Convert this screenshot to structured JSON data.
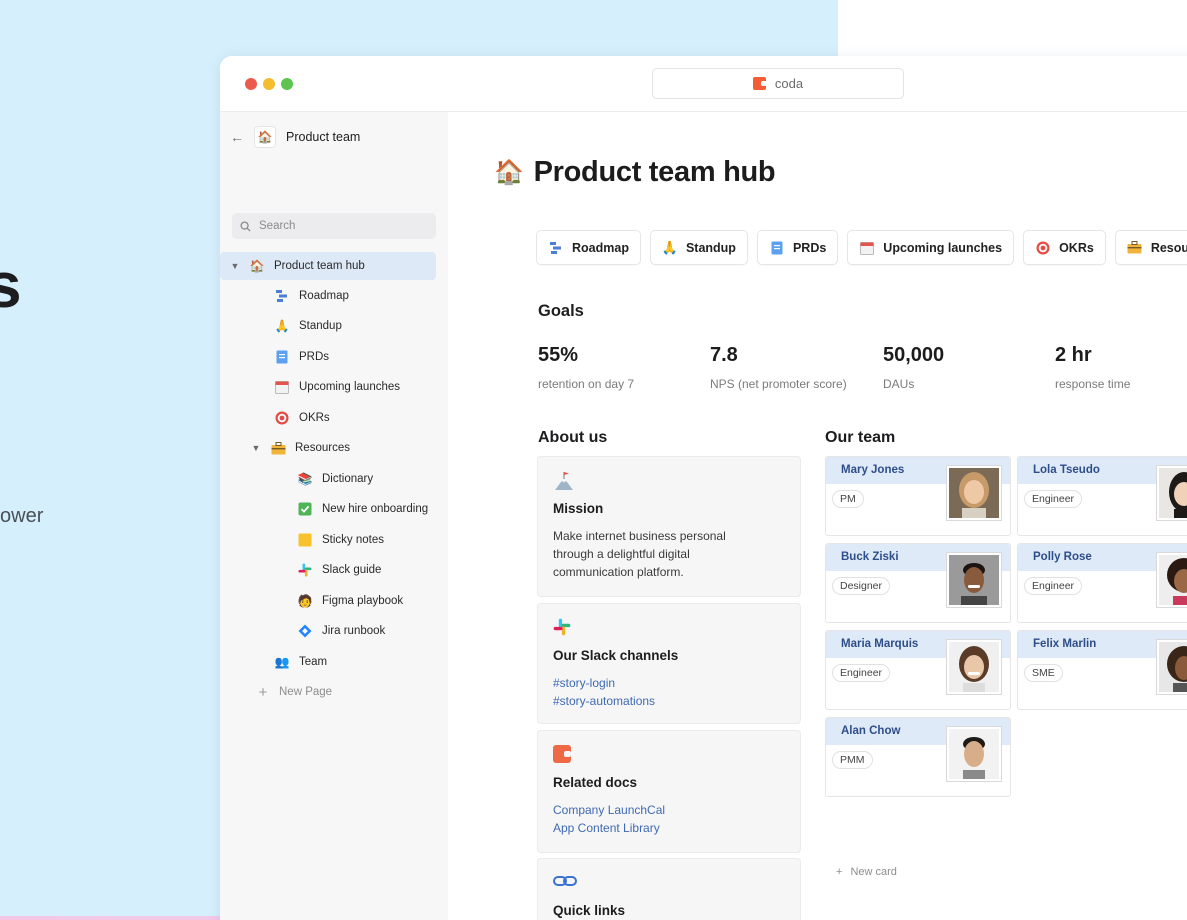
{
  "hero": {
    "partial_glyph": "s",
    "partial_word": "ower"
  },
  "browser": {
    "address": "coda"
  },
  "sidebar": {
    "doc_title": "Product team",
    "search_placeholder": "Search",
    "items": [
      {
        "label": "Product team hub",
        "icon": "house-icon"
      },
      {
        "label": "Roadmap",
        "icon": "roadmap-icon"
      },
      {
        "label": "Standup",
        "icon": "folded-hands-icon"
      },
      {
        "label": "PRDs",
        "icon": "document-icon"
      },
      {
        "label": "Upcoming launches",
        "icon": "calendar-icon"
      },
      {
        "label": "OKRs",
        "icon": "target-icon"
      },
      {
        "label": "Resources",
        "icon": "toolbox-icon"
      },
      {
        "label": "Dictionary",
        "icon": "book-icon"
      },
      {
        "label": "New hire onboarding",
        "icon": "checkbox-icon"
      },
      {
        "label": "Sticky notes",
        "icon": "sticky-note-icon"
      },
      {
        "label": "Slack guide",
        "icon": "slack-icon"
      },
      {
        "label": "Figma playbook",
        "icon": "person-icon"
      },
      {
        "label": "Jira runbook",
        "icon": "jira-diamond-icon"
      },
      {
        "label": "Team",
        "icon": "people-icon"
      },
      {
        "label": "New Page",
        "icon": "plus-icon"
      }
    ]
  },
  "page": {
    "title": "Product team hub",
    "chips": [
      {
        "label": "Roadmap",
        "icon": "roadmap-icon"
      },
      {
        "label": "Standup",
        "icon": "folded-hands-icon"
      },
      {
        "label": "PRDs",
        "icon": "document-icon"
      },
      {
        "label": "Upcoming launches",
        "icon": "calendar-icon"
      },
      {
        "label": "OKRs",
        "icon": "target-icon"
      },
      {
        "label": "Resource",
        "icon": "toolbox-icon"
      }
    ],
    "goals_title": "Goals",
    "goals": [
      {
        "value": "55%",
        "label": "retention on day 7"
      },
      {
        "value": "7.8",
        "label": "NPS (net promoter score)"
      },
      {
        "value": "50,000",
        "label": "DAUs"
      },
      {
        "value": "2 hr",
        "label": "response time"
      }
    ],
    "about_title": "About us",
    "about": {
      "mission": {
        "heading": "Mission",
        "line1": "Make internet business personal",
        "line2": "through a delightful digital",
        "line3": "communication platform."
      },
      "slack": {
        "heading": "Our Slack channels",
        "links": [
          "#story-login",
          "#story-automations"
        ]
      },
      "docs": {
        "heading": "Related docs",
        "links": [
          "Company LaunchCal",
          "App Content Library"
        ]
      },
      "quick": {
        "heading": "Quick links"
      }
    },
    "team_title": "Our team",
    "team": [
      {
        "name": "Mary Jones",
        "role": "PM"
      },
      {
        "name": "Lola Tseudo",
        "role": "Engineer"
      },
      {
        "name": "Buck Ziski",
        "role": "Designer"
      },
      {
        "name": "Polly Rose",
        "role": "Engineer"
      },
      {
        "name": "Maria Marquis",
        "role": "Engineer"
      },
      {
        "name": "Felix Marlin",
        "role": "SME"
      },
      {
        "name": "Alan Chow",
        "role": "PMM"
      }
    ],
    "new_card": "New card"
  },
  "colors": {
    "background": "#d6effc",
    "accent": "#f45c36",
    "link": "#3f6ab1",
    "team_header": "#dfeaf8"
  }
}
